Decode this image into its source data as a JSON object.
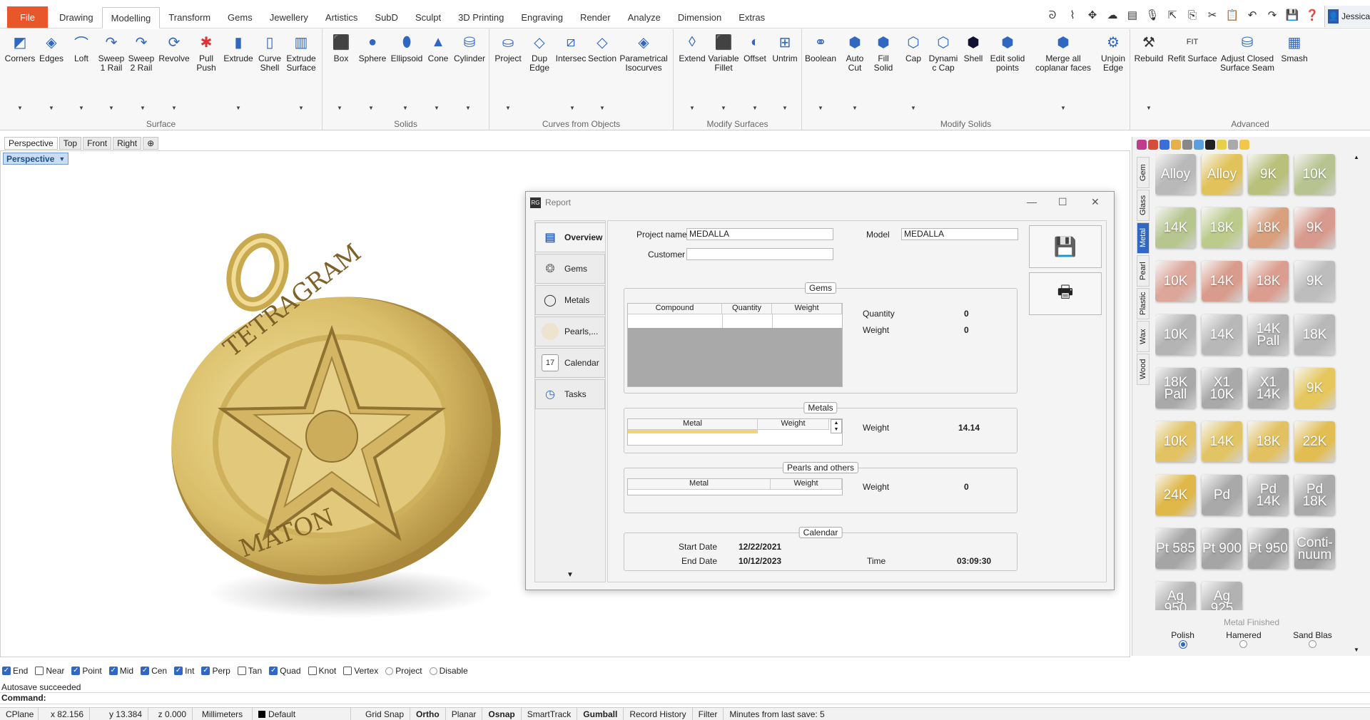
{
  "menu": {
    "tabs": [
      "File",
      "Drawing",
      "Modelling",
      "Transform",
      "Gems",
      "Jewellery",
      "Artistics",
      "SubD",
      "Sculpt",
      "3D Printing",
      "Engraving",
      "Render",
      "Analyze",
      "Dimension",
      "Extras"
    ],
    "active": "Modelling",
    "user": "Jessica"
  },
  "ribbon": {
    "groups": {
      "surface": "Surface",
      "solids": "Solids",
      "curves": "Curves from Objects",
      "modify_surfaces": "Modify Surfaces",
      "modify_solids": "Modify Solids",
      "advanced": "Advanced"
    },
    "buttons": {
      "corners": "Corners",
      "edges": "Edges",
      "loft": "Loft",
      "sweep1": "Sweep 1 Rail",
      "sweep2": "Sweep 2 Rail",
      "revolve": "Revolve",
      "pullpush": "Pull Push",
      "extrude": "Extrude",
      "curveshell": "Curve Shell",
      "extrudesurface": "Extrude Surface",
      "box": "Box",
      "sphere": "Sphere",
      "ellipsoid": "Ellipsoid",
      "cone": "Cone",
      "cylinder": "Cylinder",
      "project": "Project",
      "dupedge": "Dup Edge",
      "intersec": "Intersec",
      "section": "Section",
      "parametrical": "Parametrical Isocurves",
      "extend": "Extend",
      "variablefillet": "Variable Fillet",
      "offset": "Offset",
      "untrim": "Untrim",
      "boolean": "Boolean",
      "autocut": "Auto Cut",
      "fillsolid": "Fill Solid",
      "cap": "Cap",
      "dynamiccap": "Dynami c Cap",
      "shell": "Shell",
      "editsolid": "Edit solid points",
      "mergecoplanar": "Merge all coplanar faces",
      "unjoinedge": "Unjoin Edge",
      "rebuild": "Rebuild",
      "refit": "Refit Surface",
      "adjustseam": "Adjust Closed Surface Seam",
      "smash": "Smash"
    }
  },
  "viewports": {
    "tabs": [
      "Perspective",
      "Top",
      "Front",
      "Right"
    ],
    "active_label": "Perspective"
  },
  "pendant_text": {
    "top": "TETRAGRAM",
    "bottom": "MATON"
  },
  "report": {
    "title": "Report",
    "nav": [
      "Overview",
      "Gems",
      "Metals",
      "Pearls,...",
      "Calendar",
      "Tasks"
    ],
    "project_name_label": "Project name",
    "project_name": "MEDALLA",
    "model_label": "Model",
    "model": "MEDALLA",
    "customer_label": "Customer",
    "customer": "",
    "gems": {
      "title": "Gems",
      "columns": [
        "Compound",
        "Quantity",
        "Weight"
      ],
      "quantity_label": "Quantity",
      "quantity": "0",
      "weight_label": "Weight",
      "weight": "0"
    },
    "metals": {
      "title": "Metals",
      "columns": [
        "Metal",
        "Weight"
      ],
      "weight_label": "Weight",
      "weight": "14.14"
    },
    "pearls": {
      "title": "Pearls and others",
      "columns": [
        "Metal",
        "Weight"
      ],
      "weight_label": "Weight",
      "weight": "0"
    },
    "calendar": {
      "title": "Calendar",
      "start_label": "Start Date",
      "start": "12/22/2021",
      "end_label": "End Date",
      "end": "10/12/2023",
      "time_label": "Time",
      "time": "03:09:30"
    }
  },
  "materials": {
    "tabs": [
      "Gem",
      "Glass",
      "Metal",
      "Pearl",
      "Plastic",
      "Wax",
      "Wood"
    ],
    "active_tab": "Metal",
    "swatches": [
      {
        "label": "Alloy",
        "color": "#b9b9b9"
      },
      {
        "label": "Alloy",
        "color": "#e2c25a"
      },
      {
        "label": "9K",
        "color": "#b8c07a"
      },
      {
        "label": "10K",
        "color": "#b7c390"
      },
      {
        "label": "14K",
        "color": "#b7c58e"
      },
      {
        "label": "18K",
        "color": "#bccb8c"
      },
      {
        "label": "18K",
        "color": "#d9a07e"
      },
      {
        "label": "9K",
        "color": "#d89a8e"
      },
      {
        "label": "10K",
        "color": "#dca69a"
      },
      {
        "label": "14K",
        "color": "#d99c8c"
      },
      {
        "label": "18K",
        "color": "#db9d90"
      },
      {
        "label": "9K",
        "color": "#bdbdbd"
      },
      {
        "label": "10K",
        "color": "#b4b4b4"
      },
      {
        "label": "14K",
        "color": "#b8b8b8"
      },
      {
        "label": "14K Pall",
        "color": "#b3b3b3"
      },
      {
        "label": "18K",
        "color": "#b8b8b8"
      },
      {
        "label": "18K Pall",
        "color": "#a9a9a9"
      },
      {
        "label": "X1 10K",
        "color": "#a9a9a9"
      },
      {
        "label": "X1 14K",
        "color": "#a9a9a9"
      },
      {
        "label": "9K",
        "color": "#e6c75e"
      },
      {
        "label": "10K",
        "color": "#e2c262"
      },
      {
        "label": "14K",
        "color": "#e3c465"
      },
      {
        "label": "18K",
        "color": "#e3c160"
      },
      {
        "label": "22K",
        "color": "#e2bd52"
      },
      {
        "label": "24K",
        "color": "#e0b84a"
      },
      {
        "label": "Pd",
        "color": "#a9a9a9"
      },
      {
        "label": "Pd 14K",
        "color": "#a9a9a9"
      },
      {
        "label": "Pd 18K",
        "color": "#aaaaaa"
      },
      {
        "label": "Pt 585",
        "color": "#a5a5a5"
      },
      {
        "label": "Pt 900",
        "color": "#a5a5a5"
      },
      {
        "label": "Pt 950",
        "color": "#a3a3a3"
      },
      {
        "label": "Conti- nuum",
        "color": "#a0a0a0"
      },
      {
        "label": "Ag 950",
        "color": "#b2b2b2"
      },
      {
        "label": "Ag 925",
        "color": "#b2b2b2"
      }
    ],
    "finish_title": "Metal Finished",
    "finishes": [
      "Polish",
      "Hamered",
      "Sand Blas"
    ],
    "finish_selected": "Polish"
  },
  "osnap": [
    {
      "label": "End",
      "on": true
    },
    {
      "label": "Near",
      "on": false
    },
    {
      "label": "Point",
      "on": true
    },
    {
      "label": "Mid",
      "on": true
    },
    {
      "label": "Cen",
      "on": true
    },
    {
      "label": "Int",
      "on": true
    },
    {
      "label": "Perp",
      "on": true
    },
    {
      "label": "Tan",
      "on": false
    },
    {
      "label": "Quad",
      "on": true
    },
    {
      "label": "Knot",
      "on": false
    },
    {
      "label": "Vertex",
      "on": false
    }
  ],
  "osnap_extra": [
    "Project",
    "Disable"
  ],
  "command": {
    "history": "Autosave succeeded",
    "prompt": "Command:"
  },
  "status": {
    "cplane": "CPlane",
    "x": "x 82.156",
    "y": "y 13.384",
    "z": "z 0.000",
    "units": "Millimeters",
    "layer": "Default",
    "gridsnap": "Grid Snap",
    "ortho": "Ortho",
    "planar": "Planar",
    "osnap": "Osnap",
    "smarttrack": "SmartTrack",
    "gumball": "Gumball",
    "history": "Record History",
    "filter": "Filter",
    "autosave": "Minutes from last save: 5"
  }
}
